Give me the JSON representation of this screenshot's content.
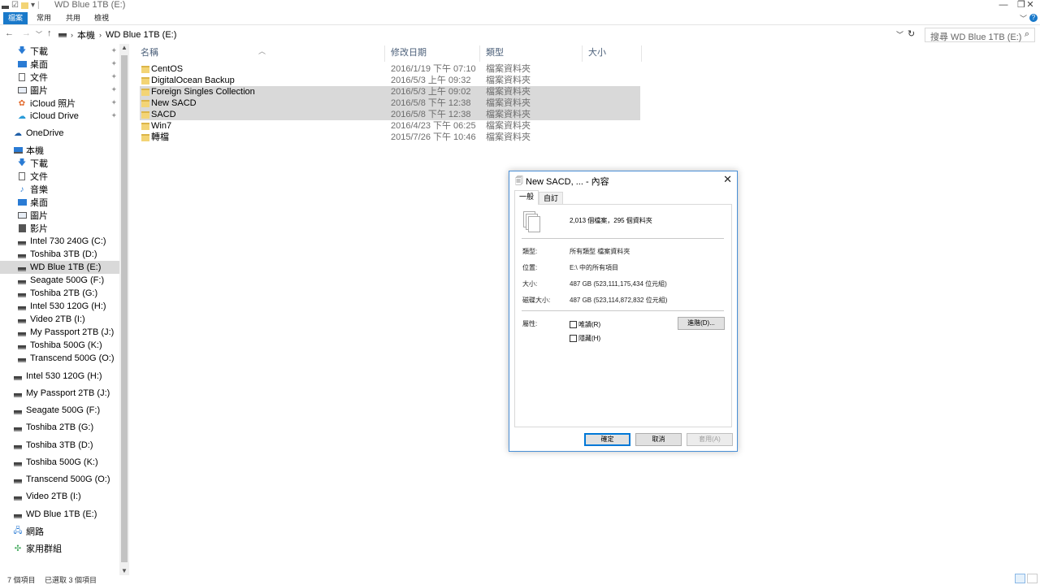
{
  "window": {
    "title": "WD Blue 1TB (E:)",
    "minimize": "—",
    "maximize": "❐",
    "close": "✕"
  },
  "ribbon": {
    "tabs": [
      "檔案",
      "常用",
      "共用",
      "檢視"
    ],
    "active_tab": "檔案"
  },
  "address": {
    "segments": [
      "本機",
      "WD Blue 1TB (E:)"
    ],
    "search_placeholder": "搜尋 WD Blue 1TB (E:)"
  },
  "sidebar": {
    "quick_access": [
      {
        "label": "下載",
        "icon": "download-icon",
        "pinned": true
      },
      {
        "label": "桌面",
        "icon": "desktop-icon",
        "pinned": true
      },
      {
        "label": "文件",
        "icon": "document-icon",
        "pinned": true
      },
      {
        "label": "圖片",
        "icon": "picture-icon",
        "pinned": true
      },
      {
        "label": "iCloud 照片",
        "icon": "icloud-photos-icon",
        "pinned": true
      },
      {
        "label": "iCloud Drive",
        "icon": "icloud-drive-icon",
        "pinned": true
      }
    ],
    "onedrive": "OneDrive",
    "this_pc": "本機",
    "this_pc_items": [
      "下載",
      "文件",
      "音樂",
      "桌面",
      "圖片",
      "影片",
      "Intel 730 240G (C:)",
      "Toshiba 3TB (D:)",
      "WD Blue 1TB (E:)",
      "Seagate 500G (F:)",
      "Toshiba 2TB (G:)",
      "Intel 530 120G (H:)",
      "Video 2TB (I:)",
      "My Passport 2TB (J:)",
      "Toshiba 500G (K:)",
      "Transcend 500G (O:)"
    ],
    "selected": "WD Blue 1TB (E:)",
    "drives": [
      "Intel 530 120G (H:)",
      "My Passport 2TB (J:)",
      "Seagate 500G (F:)",
      "Toshiba 2TB (G:)",
      "Toshiba 3TB (D:)",
      "Toshiba 500G (K:)",
      "Transcend 500G (O:)",
      "Video 2TB (I:)",
      "WD Blue 1TB (E:)"
    ],
    "network": "網路",
    "homegroup": "家用群組"
  },
  "filelist": {
    "columns": [
      "名稱",
      "修改日期",
      "類型",
      "大小"
    ],
    "rows": [
      {
        "name": "CentOS",
        "date": "2016/1/19 下午 07:10",
        "type": "檔案資料夾",
        "selected": false
      },
      {
        "name": "DigitalOcean Backup",
        "date": "2016/5/3 上午 09:32",
        "type": "檔案資料夾",
        "selected": false
      },
      {
        "name": "Foreign Singles Collection",
        "date": "2016/5/3 上午 09:02",
        "type": "檔案資料夾",
        "selected": true
      },
      {
        "name": "New SACD",
        "date": "2016/5/8 下午 12:38",
        "type": "檔案資料夾",
        "selected": true
      },
      {
        "name": "SACD",
        "date": "2016/5/8 下午 12:38",
        "type": "檔案資料夾",
        "selected": true
      },
      {
        "name": "Win7",
        "date": "2016/4/23 下午 06:25",
        "type": "檔案資料夾",
        "selected": false
      },
      {
        "name": "轉檔",
        "date": "2015/7/26 下午 10:46",
        "type": "檔案資料夾",
        "selected": false
      }
    ]
  },
  "status": {
    "count": "7 個項目",
    "selected": "已選取 3 個項目"
  },
  "dialog": {
    "title": "New SACD, ... - 內容",
    "tabs": [
      "一般",
      "自訂"
    ],
    "summary": "2,013 個檔案，295 個資料夾",
    "type_label": "類型:",
    "type_value": "所有類型 檔案資料夾",
    "location_label": "位置:",
    "location_value": "E:\\ 中的所有項目",
    "size_label": "大小:",
    "size_value": "487 GB (523,111,175,434 位元組)",
    "disk_size_label": "磁碟大小:",
    "disk_size_value": "487 GB (523,114,872,832 位元組)",
    "attributes_label": "屬性:",
    "readonly_label": "唯讀(R)",
    "hidden_label": "隱藏(H)",
    "advanced_button": "進階(D)...",
    "ok_button": "確定",
    "cancel_button": "取消",
    "apply_button": "套用(A)"
  }
}
